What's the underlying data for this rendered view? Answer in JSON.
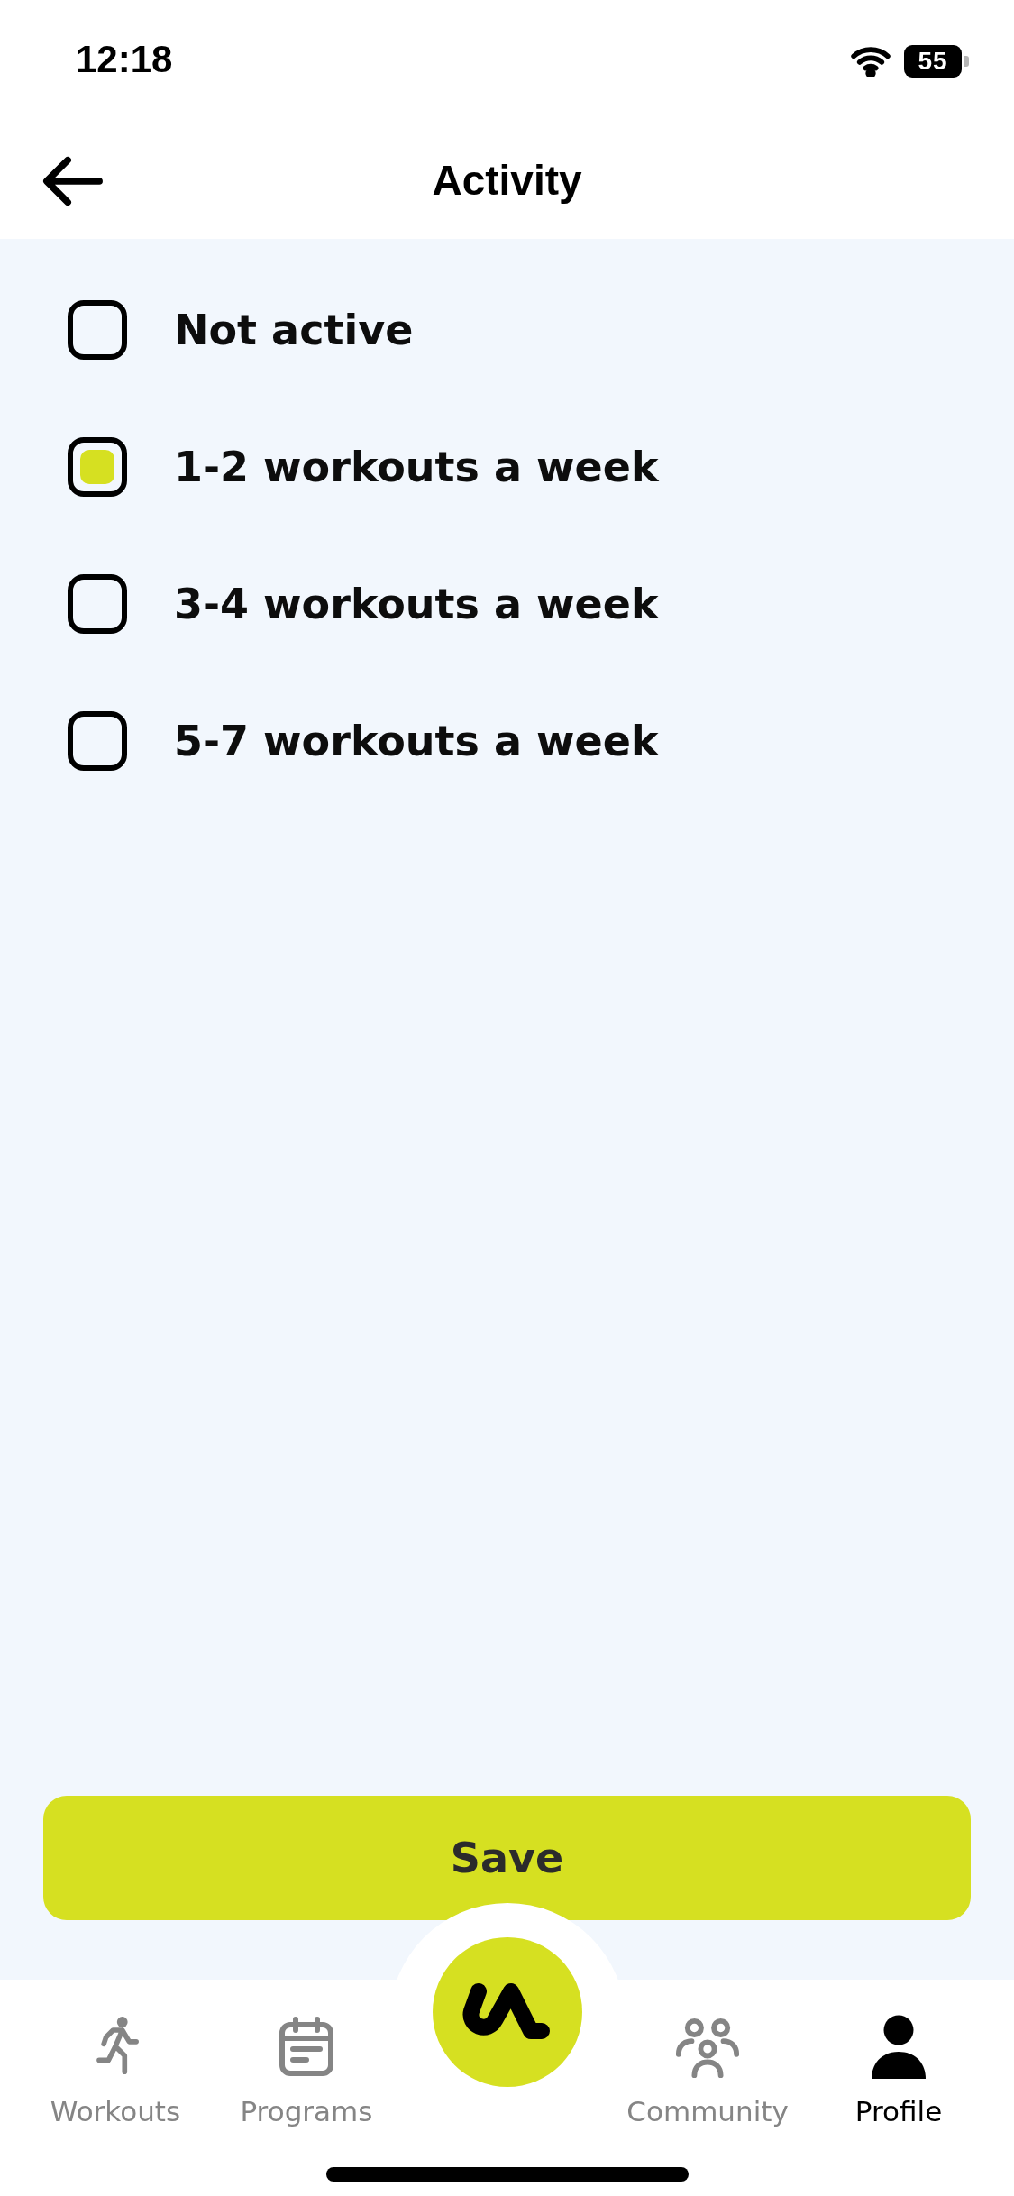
{
  "status_bar": {
    "time": "12:18",
    "battery": "55"
  },
  "header": {
    "title": "Activity"
  },
  "options": [
    {
      "label": "Not active",
      "selected": false
    },
    {
      "label": "1-2 workouts a week",
      "selected": true
    },
    {
      "label": "3-4 workouts a week",
      "selected": false
    },
    {
      "label": "5-7 workouts a week",
      "selected": false
    }
  ],
  "save_button": {
    "label": "Save"
  },
  "tab_bar": [
    {
      "label": "Workouts",
      "selected": false
    },
    {
      "label": "Programs",
      "selected": false
    },
    {
      "label": "Community",
      "selected": false
    },
    {
      "label": "Profile",
      "selected": true
    }
  ]
}
